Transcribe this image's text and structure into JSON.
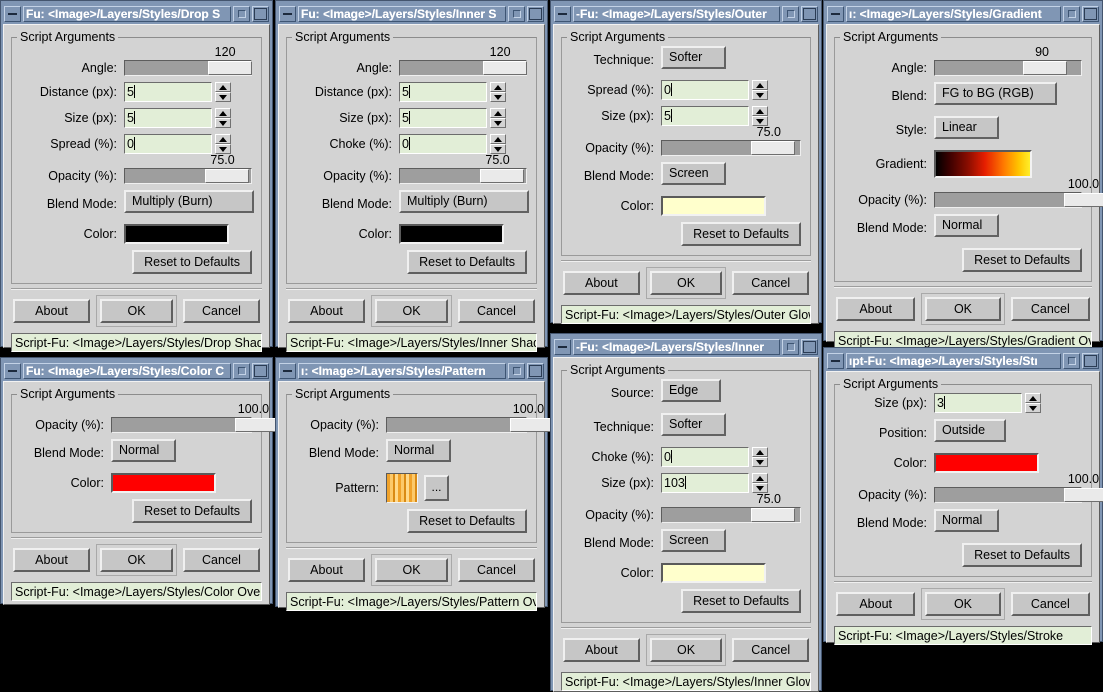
{
  "desktop": {
    "background": "#000000"
  },
  "theme": {
    "titlebar_bg": "#8096b4",
    "client_bg": "#d3d3d3",
    "entry_bg": "#e2eed7",
    "accent_red": "#ff0000",
    "glow_yellow": "#ffffcc",
    "black_swatch": "#000000"
  },
  "windows": [
    {
      "id": "drop-shadow",
      "title": "Fu: <Image>/Layers/Styles/Drop S",
      "frame_legend": "Script Arguments",
      "status": "Script-Fu: <Image>/Layers/Styles/Drop Shad",
      "rows": [
        {
          "type": "slider",
          "label": "Angle:",
          "value": "120",
          "percent": 72
        },
        {
          "type": "spin",
          "label": "Distance (px):",
          "value": "5"
        },
        {
          "type": "spin",
          "label": "Size (px):",
          "value": "5"
        },
        {
          "type": "spin",
          "label": "Spread (%):",
          "value": "0"
        },
        {
          "type": "slider",
          "label": "Opacity (%):",
          "value": "75.0",
          "percent": 70
        },
        {
          "type": "option",
          "label": "Blend Mode:",
          "value": "Multiply (Burn)"
        },
        {
          "type": "color",
          "label": "Color:",
          "value": "#000000"
        }
      ],
      "reset_label": "Reset to Defaults",
      "about_label": "About",
      "ok_label": "OK",
      "cancel_label": "Cancel"
    },
    {
      "id": "inner-shadow",
      "title": "Fu: <Image>/Layers/Styles/Inner S",
      "frame_legend": "Script Arguments",
      "status": "Script-Fu: <Image>/Layers/Styles/Inner Shad",
      "rows": [
        {
          "type": "slider",
          "label": "Angle:",
          "value": "120",
          "percent": 72
        },
        {
          "type": "spin",
          "label": "Distance (px):",
          "value": "5"
        },
        {
          "type": "spin",
          "label": "Size (px):",
          "value": "5"
        },
        {
          "type": "spin",
          "label": "Choke (%):",
          "value": "0"
        },
        {
          "type": "slider",
          "label": "Opacity (%):",
          "value": "75.0",
          "percent": 70
        },
        {
          "type": "option",
          "label": "Blend Mode:",
          "value": "Multiply (Burn)"
        },
        {
          "type": "color",
          "label": "Color:",
          "value": "#000000"
        }
      ],
      "reset_label": "Reset to Defaults",
      "about_label": "About",
      "ok_label": "OK",
      "cancel_label": "Cancel"
    },
    {
      "id": "outer-glow",
      "title": "-Fu: <Image>/Layers/Styles/Outer",
      "frame_legend": "Script Arguments",
      "status": "Script-Fu: <Image>/Layers/Styles/Outer Glow",
      "rows": [
        {
          "type": "option",
          "label": "Technique:",
          "value": "Softer"
        },
        {
          "type": "spin",
          "label": "Spread (%):",
          "value": "0"
        },
        {
          "type": "spin",
          "label": "Size (px):",
          "value": "5"
        },
        {
          "type": "slider",
          "label": "Opacity (%):",
          "value": "75.0",
          "percent": 70
        },
        {
          "type": "option",
          "label": "Blend Mode:",
          "value": "Screen"
        },
        {
          "type": "color",
          "label": "Color:",
          "value": "#ffffcc"
        }
      ],
      "reset_label": "Reset to Defaults",
      "about_label": "About",
      "ok_label": "OK",
      "cancel_label": "Cancel"
    },
    {
      "id": "gradient-overlay",
      "title": "ı: <Image>/Layers/Styles/Gradient",
      "frame_legend": "Script Arguments",
      "status": "Script-Fu: <Image>/Layers/Styles/Gradient Ov",
      "rows": [
        {
          "type": "slider",
          "label": "Angle:",
          "value": "90",
          "percent": 66
        },
        {
          "type": "option",
          "label": "Blend:",
          "value": "FG to BG (RGB)"
        },
        {
          "type": "option",
          "label": "Style:",
          "value": "Linear"
        },
        {
          "type": "gradient",
          "label": "Gradient:",
          "value": "black-red-orange-yellow"
        },
        {
          "type": "slider",
          "label": "Opacity (%):",
          "value": "100.0",
          "percent": 94
        },
        {
          "type": "option",
          "label": "Blend Mode:",
          "value": "Normal"
        }
      ],
      "reset_label": "Reset to Defaults",
      "about_label": "About",
      "ok_label": "OK",
      "cancel_label": "Cancel"
    },
    {
      "id": "color-overlay",
      "title": "Fu: <Image>/Layers/Styles/Color C",
      "frame_legend": "Script Arguments",
      "status": "Script-Fu: <Image>/Layers/Styles/Color Over",
      "rows": [
        {
          "type": "slider",
          "label": "Opacity (%):",
          "value": "100.0",
          "percent": 94
        },
        {
          "type": "option",
          "label": "Blend Mode:",
          "value": "Normal"
        },
        {
          "type": "color",
          "label": "Color:",
          "value": "#ff0000"
        }
      ],
      "reset_label": "Reset to Defaults",
      "about_label": "About",
      "ok_label": "OK",
      "cancel_label": "Cancel"
    },
    {
      "id": "pattern-overlay",
      "title": "ı: <Image>/Layers/Styles/Pattern",
      "frame_legend": "Script Arguments",
      "status": "Script-Fu: <Image>/Layers/Styles/Pattern Ov",
      "rows": [
        {
          "type": "slider",
          "label": "Opacity (%):",
          "value": "100.0",
          "percent": 94
        },
        {
          "type": "option",
          "label": "Blend Mode:",
          "value": "Normal"
        },
        {
          "type": "pattern",
          "label": "Pattern:",
          "value": "wood-stripes",
          "browse_label": "..."
        }
      ],
      "reset_label": "Reset to Defaults",
      "about_label": "About",
      "ok_label": "OK",
      "cancel_label": "Cancel"
    },
    {
      "id": "inner-glow",
      "title": "-Fu: <Image>/Layers/Styles/Inner",
      "frame_legend": "Script Arguments",
      "status": "Script-Fu: <Image>/Layers/Styles/Inner Glow",
      "rows": [
        {
          "type": "option",
          "label": "Source:",
          "value": "Edge"
        },
        {
          "type": "option",
          "label": "Technique:",
          "value": "Softer"
        },
        {
          "type": "spin",
          "label": "Choke (%):",
          "value": "0"
        },
        {
          "type": "spin",
          "label": "Size (px):",
          "value": "103"
        },
        {
          "type": "slider",
          "label": "Opacity (%):",
          "value": "75.0",
          "percent": 70
        },
        {
          "type": "option",
          "label": "Blend Mode:",
          "value": "Screen"
        },
        {
          "type": "color",
          "label": "Color:",
          "value": "#ffffcc"
        }
      ],
      "reset_label": "Reset to Defaults",
      "about_label": "About",
      "ok_label": "OK",
      "cancel_label": "Cancel"
    },
    {
      "id": "stroke",
      "title": "ıpt-Fu: <Image>/Layers/Styles/Stı",
      "frame_legend": "Script Arguments",
      "status": "Script-Fu: <Image>/Layers/Styles/Stroke",
      "rows": [
        {
          "type": "spin",
          "label": "Size (px):",
          "value": "3"
        },
        {
          "type": "option",
          "label": "Position:",
          "value": "Outside"
        },
        {
          "type": "color",
          "label": "Color:",
          "value": "#ff0000"
        },
        {
          "type": "slider",
          "label": "Opacity (%):",
          "value": "100.0",
          "percent": 94
        },
        {
          "type": "option",
          "label": "Blend Mode:",
          "value": "Normal"
        }
      ],
      "reset_label": "Reset to Defaults",
      "about_label": "About",
      "ok_label": "OK",
      "cancel_label": "Cancel"
    }
  ]
}
